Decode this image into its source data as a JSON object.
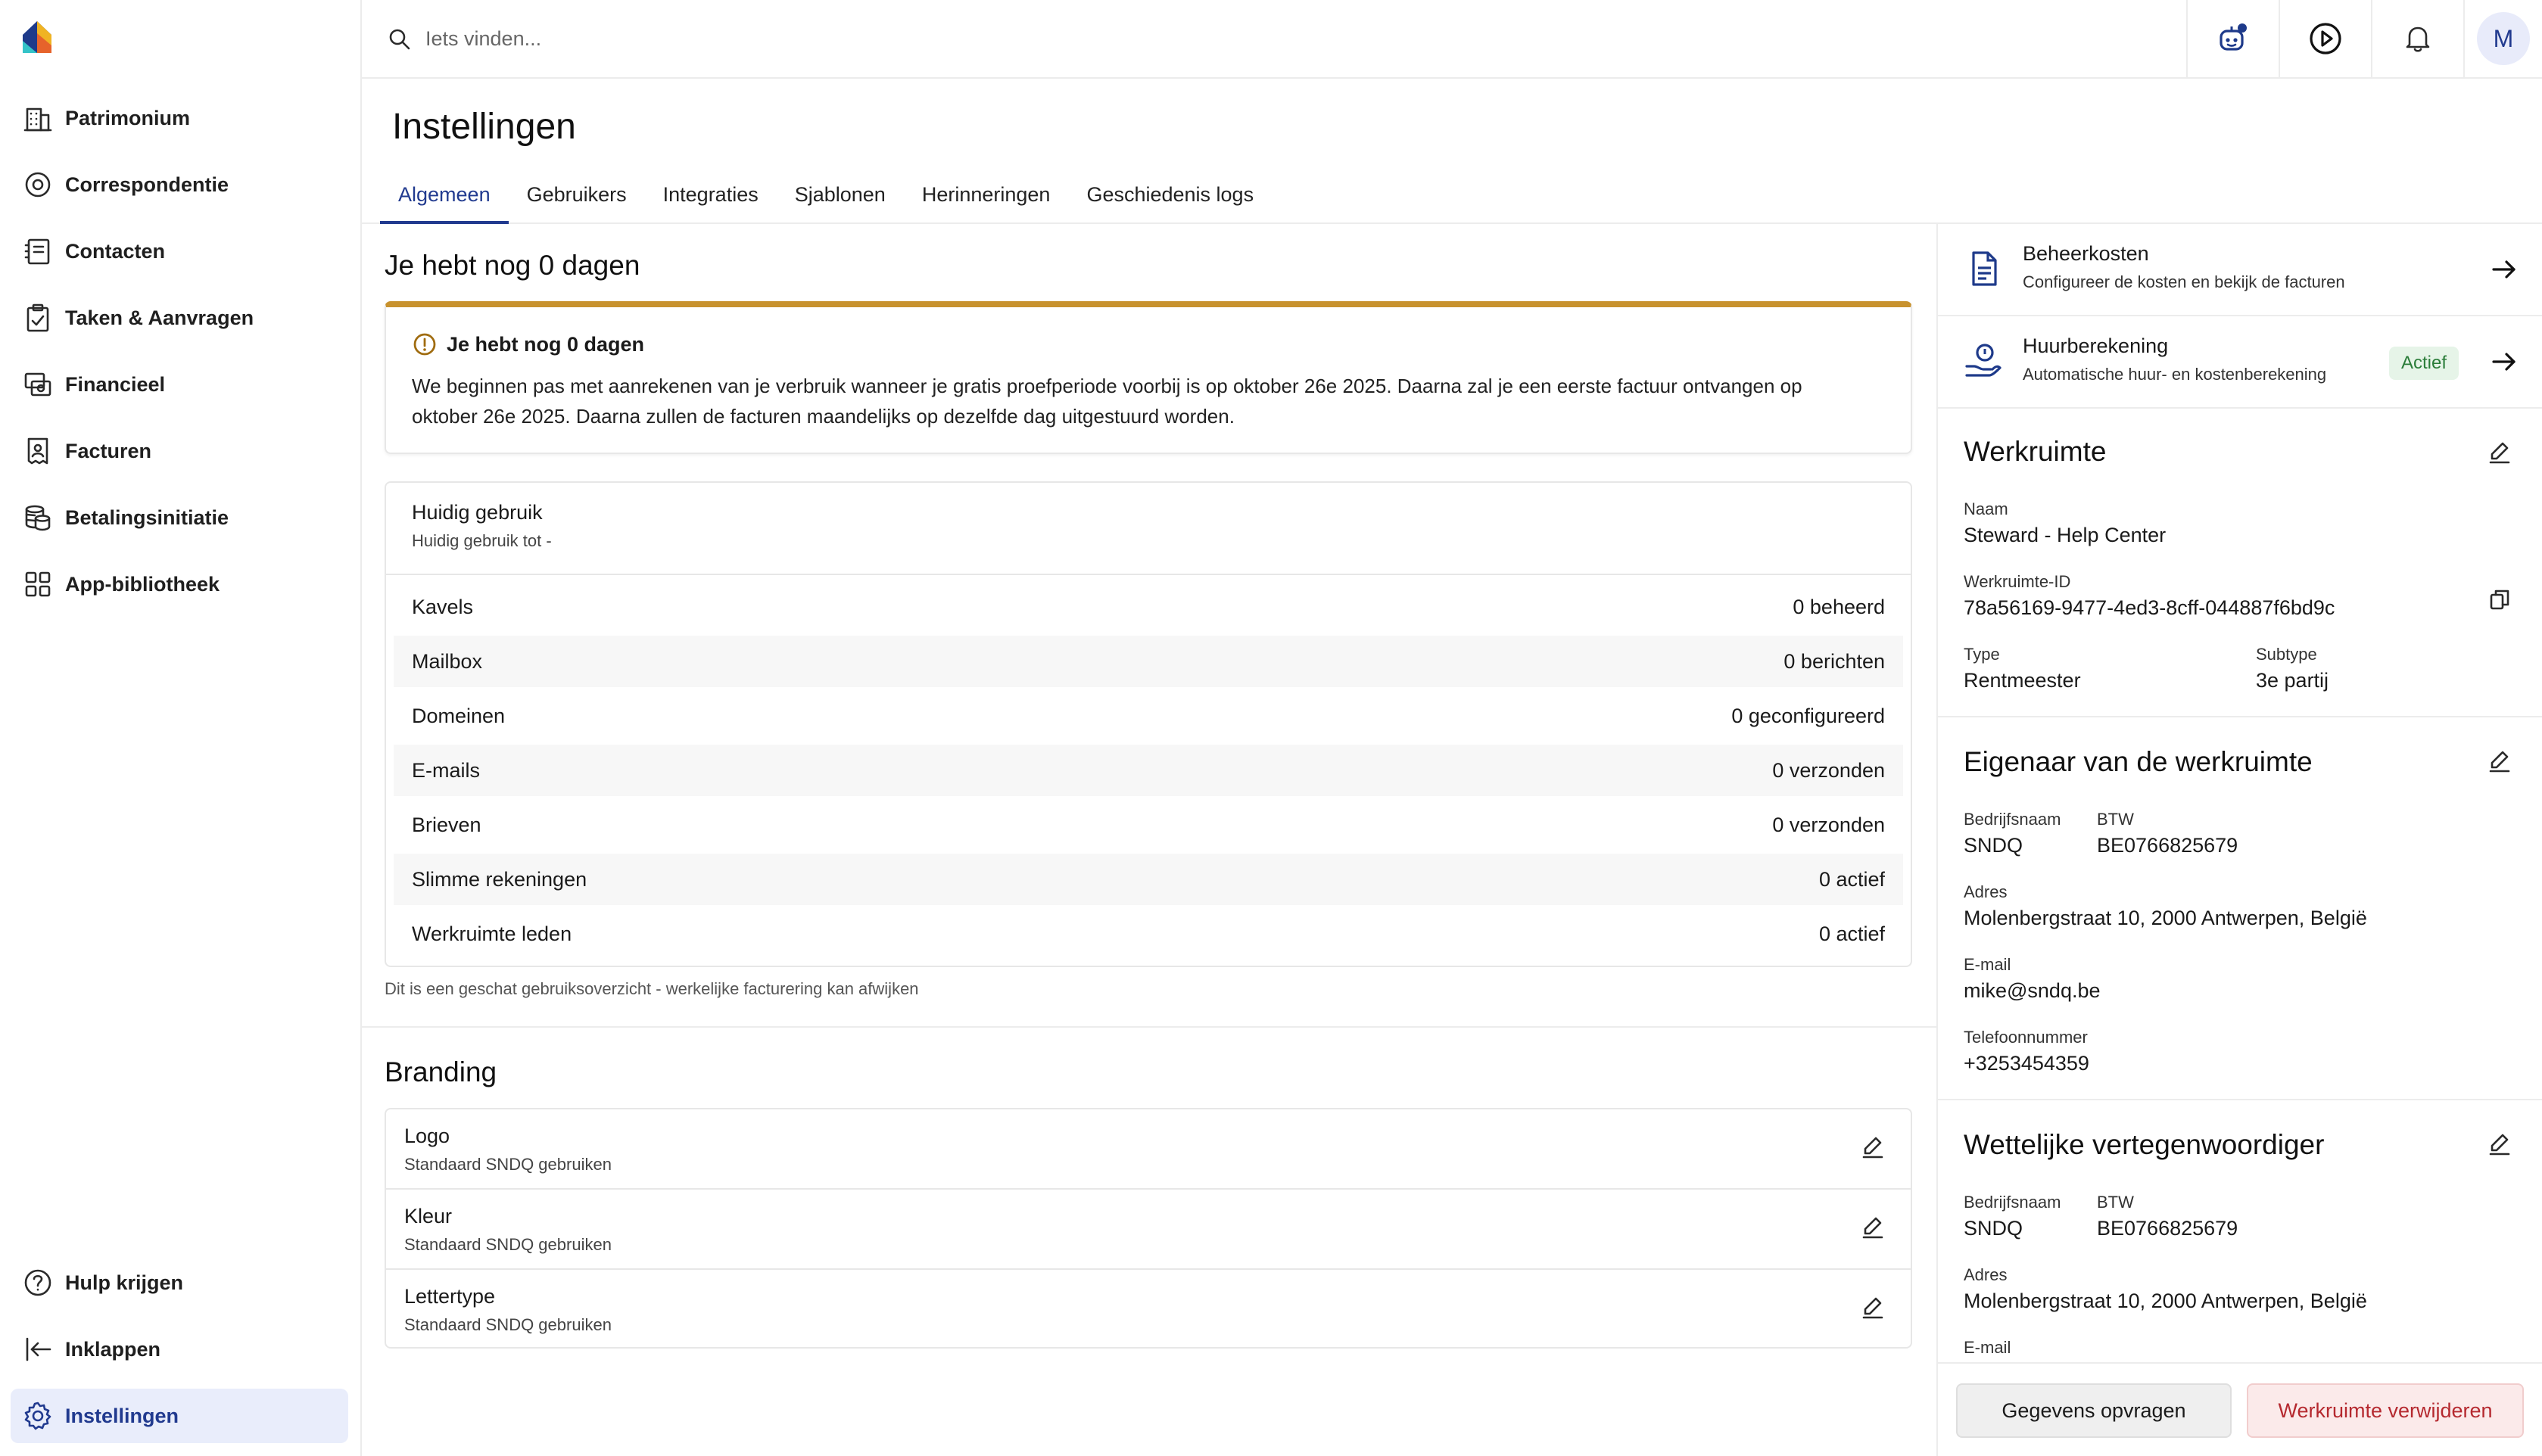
{
  "sidebar": {
    "items": [
      {
        "label": "Patrimonium",
        "icon": "building-icon"
      },
      {
        "label": "Correspondentie",
        "icon": "correspondence-icon"
      },
      {
        "label": "Contacten",
        "icon": "contacts-icon"
      },
      {
        "label": "Taken & Aanvragen",
        "icon": "tasks-icon"
      },
      {
        "label": "Financieel",
        "icon": "finance-icon"
      },
      {
        "label": "Facturen",
        "icon": "invoice-icon"
      },
      {
        "label": "Betalingsinitiatie",
        "icon": "coins-icon"
      },
      {
        "label": "App-bibliotheek",
        "icon": "apps-grid-icon"
      }
    ],
    "bottom": [
      {
        "label": "Hulp krijgen",
        "icon": "help-icon"
      },
      {
        "label": "Inklappen",
        "icon": "collapse-icon"
      },
      {
        "label": "Instellingen",
        "icon": "gear-icon",
        "active": true
      }
    ]
  },
  "search": {
    "placeholder": "Iets vinden..."
  },
  "user": {
    "initial": "M"
  },
  "page": {
    "title": "Instellingen"
  },
  "tabs": [
    "Algemeen",
    "Gebruikers",
    "Integraties",
    "Sjablonen",
    "Herinneringen",
    "Geschiedenis logs"
  ],
  "trial": {
    "section_title": "Je hebt nog 0 dagen",
    "card_title": "Je hebt nog 0 dagen",
    "text": "We beginnen pas met aanrekenen van je verbruik wanneer je gratis proefperiode voorbij is op oktober 26e 2025. Daarna zal je een eerste factuur ontvangen op oktober 26e 2025. Daarna zullen de facturen maandelijks op dezelfde dag uitgestuurd worden."
  },
  "usage": {
    "title": "Huidig gebruik",
    "subtitle": "Huidig gebruik tot -",
    "rows": [
      {
        "label": "Kavels",
        "value": "0 beheerd"
      },
      {
        "label": "Mailbox",
        "value": "0 berichten"
      },
      {
        "label": "Domeinen",
        "value": "0 geconfigureerd"
      },
      {
        "label": "E-mails",
        "value": "0 verzonden"
      },
      {
        "label": "Brieven",
        "value": "0 verzonden"
      },
      {
        "label": "Slimme rekeningen",
        "value": "0 actief"
      },
      {
        "label": "Werkruimte leden",
        "value": "0 actief"
      }
    ],
    "note": "Dit is een geschat gebruiksoverzicht - werkelijke facturering kan afwijken"
  },
  "branding": {
    "title": "Branding",
    "rows": [
      {
        "label": "Logo",
        "value": "Standaard SNDQ gebruiken"
      },
      {
        "label": "Kleur",
        "value": "Standaard SNDQ gebruiken"
      },
      {
        "label": "Lettertype",
        "value": "Standaard SNDQ gebruiken"
      }
    ]
  },
  "right": {
    "links": [
      {
        "title": "Beheerkosten",
        "subtitle": "Configureer de kosten en bekijk de facturen"
      },
      {
        "title": "Huurberekening",
        "subtitle": "Automatische huur- en kostenberekening",
        "badge": "Actief"
      }
    ],
    "workspace": {
      "title": "Werkruimte",
      "name_label": "Naam",
      "name": "Steward - Help Center",
      "id_label": "Werkruimte-ID",
      "id": "78a56169-9477-4ed3-8cff-044887f6bd9c",
      "type_label": "Type",
      "type": "Rentmeester",
      "subtype_label": "Subtype",
      "subtype": "3e partij"
    },
    "owner": {
      "title": "Eigenaar van de werkruimte",
      "company_label": "Bedrijfsnaam",
      "company": "SNDQ",
      "vat_label": "BTW",
      "vat": "BE0766825679",
      "address_label": "Adres",
      "address": "Molenbergstraat 10, 2000 Antwerpen, België",
      "email_label": "E-mail",
      "email": "mike@sndq.be",
      "phone_label": "Telefoonnummer",
      "phone": "+3253454359"
    },
    "legal": {
      "title": "Wettelijke vertegenwoordiger",
      "company_label": "Bedrijfsnaam",
      "company": "SNDQ",
      "vat_label": "BTW",
      "vat": "BE0766825679",
      "address_label": "Adres",
      "address": "Molenbergstraat 10, 2000 Antwerpen, België",
      "email_label": "E-mail"
    },
    "buttons": {
      "request": "Gegevens opvragen",
      "delete": "Werkruimte verwijderen"
    }
  },
  "colors": {
    "accent": "#213a8f",
    "warning": "#c8922e",
    "danger": "#b5292f",
    "success": "#2b7d3a"
  }
}
